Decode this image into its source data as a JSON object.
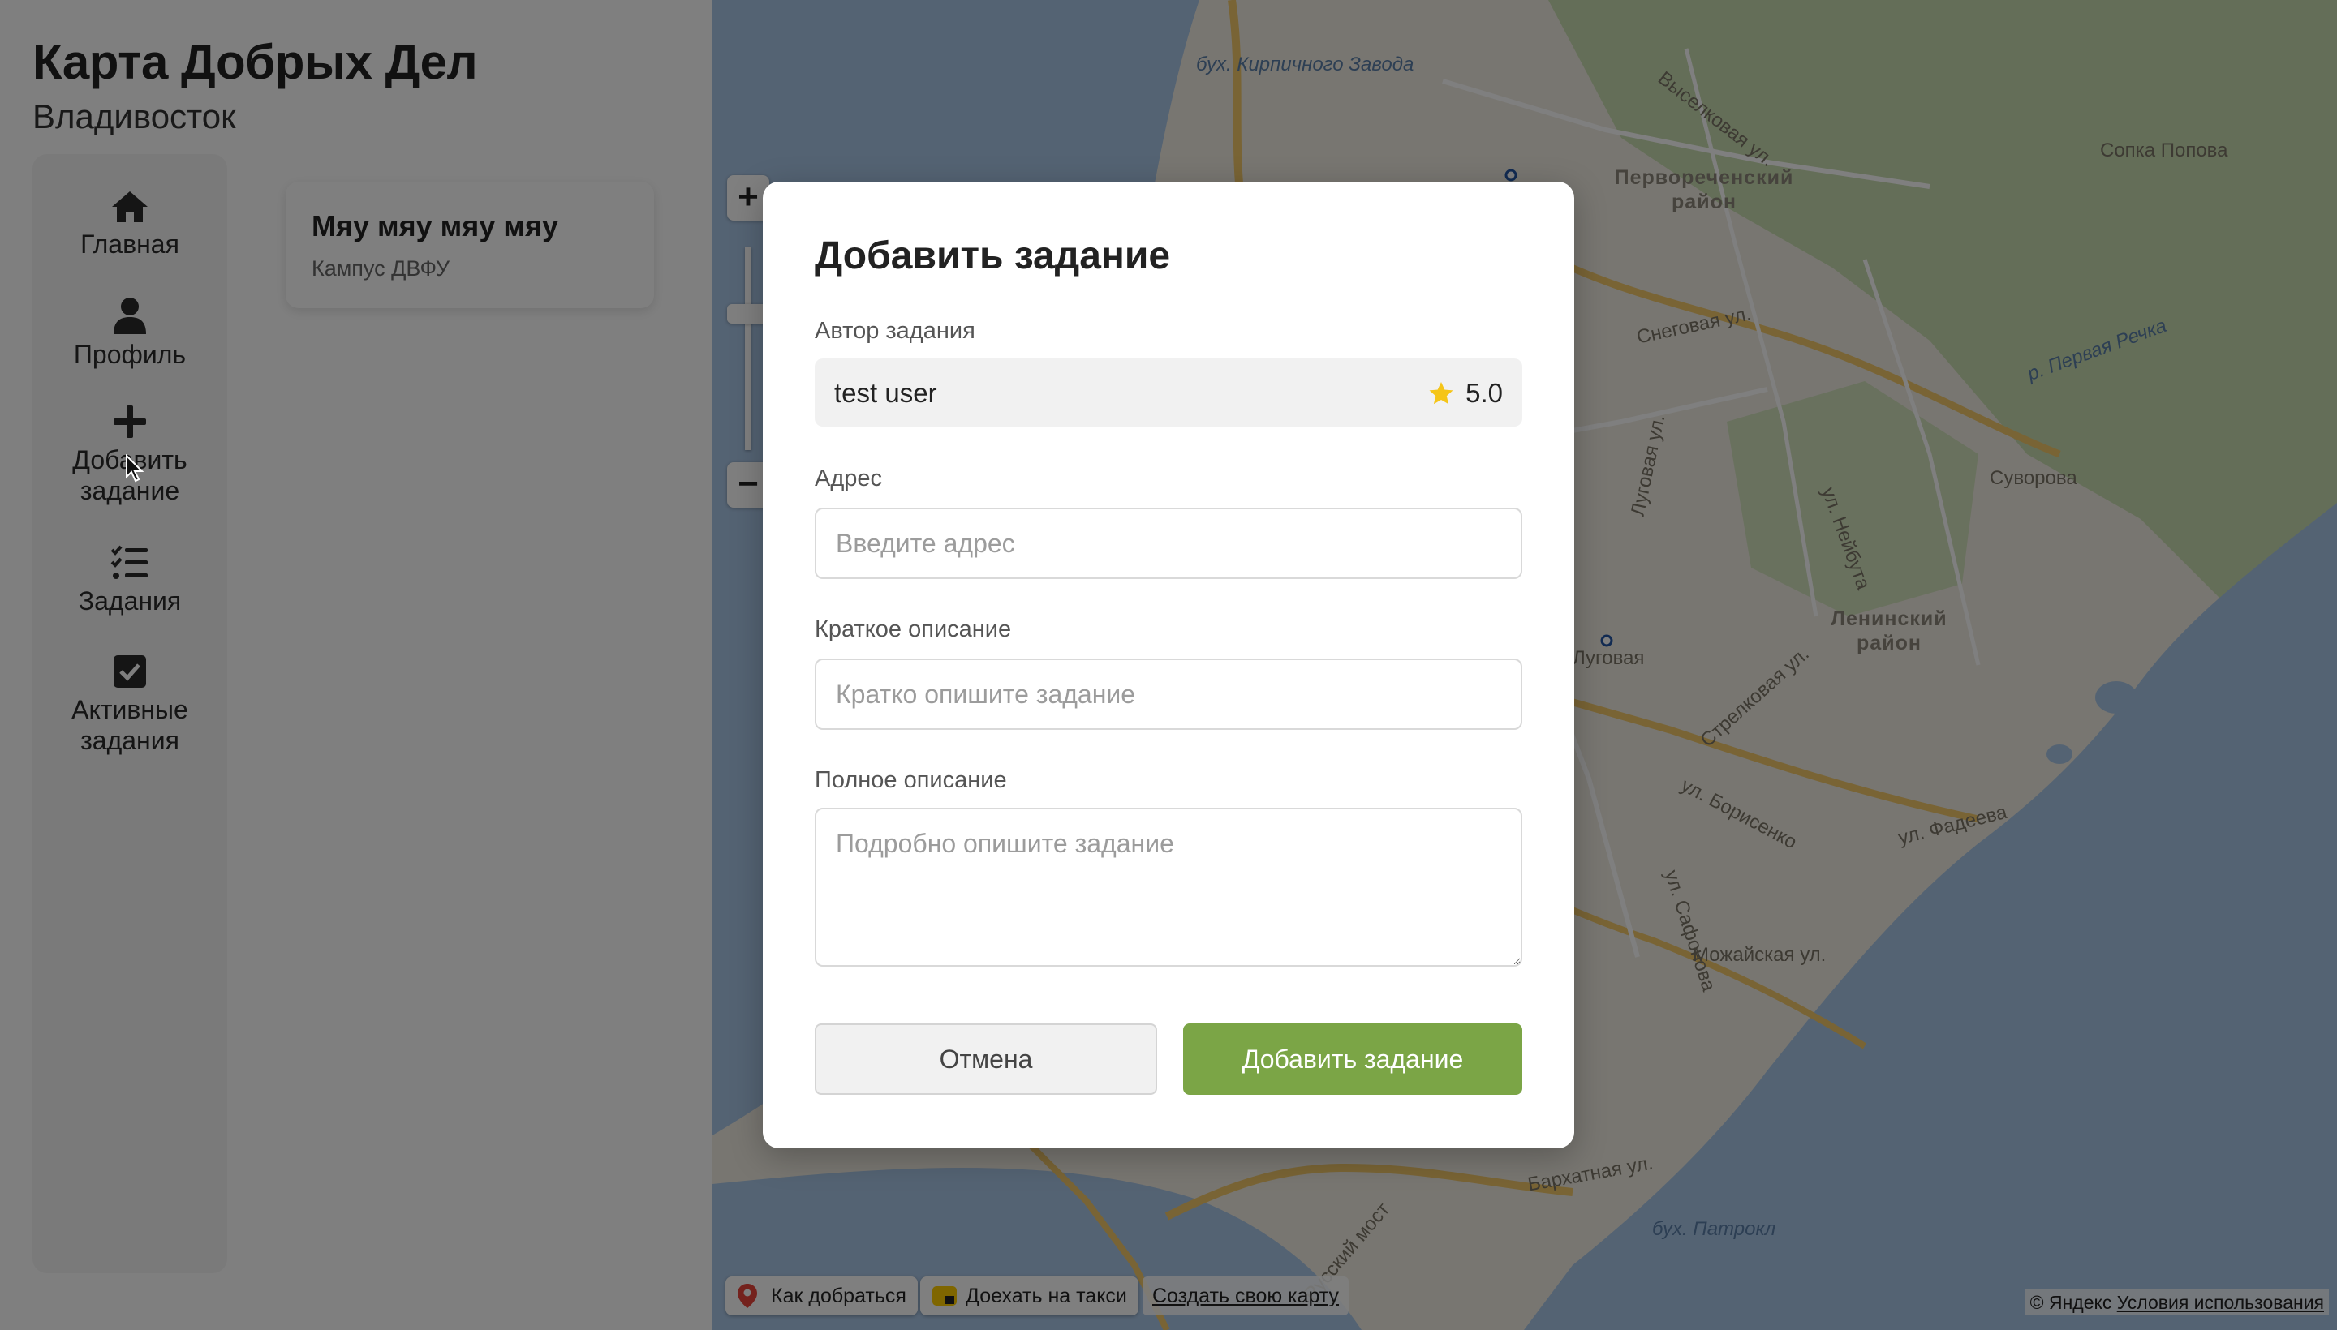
{
  "app": {
    "title": "Карта Добрых Дел",
    "city": "Владивосток"
  },
  "sidebar": {
    "items": [
      {
        "label": "Главная",
        "icon": "home-icon"
      },
      {
        "label": "Профиль",
        "icon": "user-icon"
      },
      {
        "label": "Добавить задание",
        "icon": "plus-icon"
      },
      {
        "label": "Задания",
        "icon": "task-list-icon"
      },
      {
        "label": "Активные задания",
        "icon": "checkbox-icon"
      }
    ]
  },
  "task_card": {
    "title": "Мяу мяу мяу мяу",
    "location": "Кампус ДВФУ"
  },
  "map": {
    "labels": [
      "бух. Кирпичного Завода",
      "Выселковая ул.",
      "Сопка Попова",
      "Первореченский район",
      "Снеговая ул.",
      "р. Первая Речка",
      "Луговая ул.",
      "ул. Нейбута",
      "Суворова",
      "Луговая",
      "Ленинский район",
      "Стрелковая ул.",
      "ул. Борисенко",
      "ул. Фадеева",
      "ул. Сафонова",
      "Можайская ул.",
      "Бархатная ул.",
      "Русский мост",
      "бух. Патрокл"
    ],
    "controls": {
      "zoom_in": "+",
      "zoom_out": "−"
    },
    "bottom_bar": {
      "route_label": "Как добраться",
      "taxi_label": "Доехать на такси",
      "create_map_label": "Создать свою карту"
    },
    "copyright": "© Яндекс",
    "terms_label": "Условия использования"
  },
  "modal": {
    "title": "Добавить задание",
    "author_label": "Автор задания",
    "author_name": "test user",
    "author_rating": "5.0",
    "address_label": "Адрес",
    "address_placeholder": "Введите адрес",
    "address_value": "",
    "short_label": "Краткое описание",
    "short_placeholder": "Кратко опишите задание",
    "short_value": "",
    "full_label": "Полное описание",
    "full_placeholder": "Подробно опишите задание",
    "full_value": "",
    "cancel_label": "Отмена",
    "submit_label": "Добавить задание"
  },
  "colors": {
    "accent": "#7ba546",
    "star": "#f5c518",
    "overlay": "rgba(0,0,0,0.5)",
    "map_water": "#a9c6e6",
    "map_park": "#c9ddb0"
  }
}
